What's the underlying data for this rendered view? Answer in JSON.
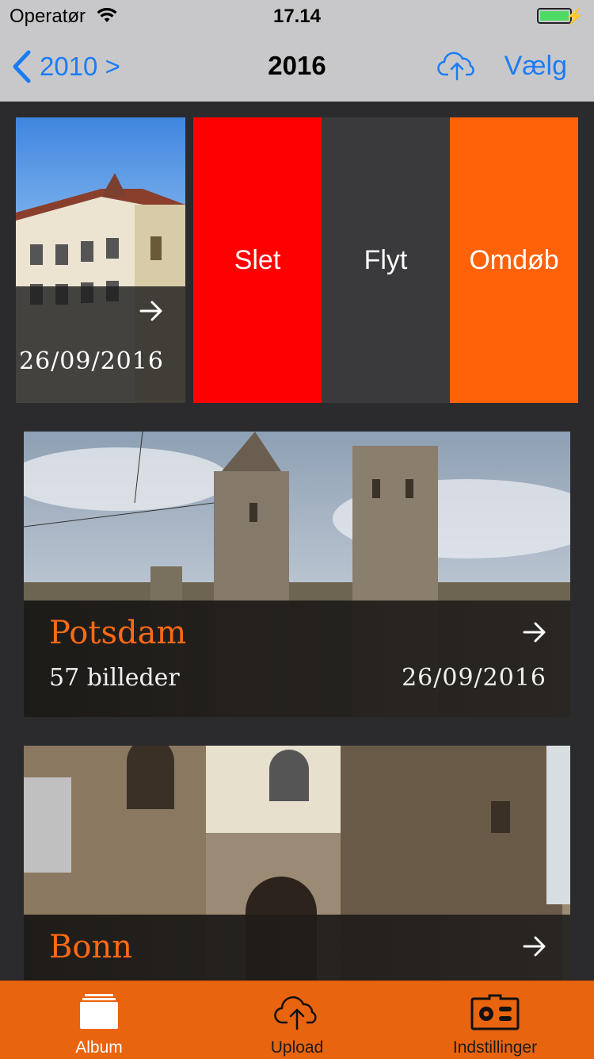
{
  "status_bar": {
    "carrier": "Operatør",
    "time": "17.14",
    "battery_level": 1.0
  },
  "nav": {
    "back_label": "2010 >",
    "title": "2016",
    "select_label": "Vælg",
    "accent": "#1a7cf4"
  },
  "swipe_row": {
    "date": "26/09/2016",
    "actions": {
      "delete": "Slet",
      "move": "Flyt",
      "rename": "Omdøb"
    },
    "colors": {
      "delete": "#ff0000",
      "move": "#3a3a3c",
      "rename": "#ff6208"
    }
  },
  "albums": [
    {
      "name": "Potsdam",
      "count": "57 billeder",
      "date": "26/09/2016"
    },
    {
      "name": "Bonn"
    }
  ],
  "tabs": {
    "album": "Album",
    "upload": "Upload",
    "settings": "Indstillinger"
  },
  "tab_bar_color": "#e8640f",
  "icons": [
    "chevron-left-icon",
    "cloud-upload-icon",
    "arrow-right-icon",
    "album-stack-icon",
    "settings-gear-icon"
  ]
}
